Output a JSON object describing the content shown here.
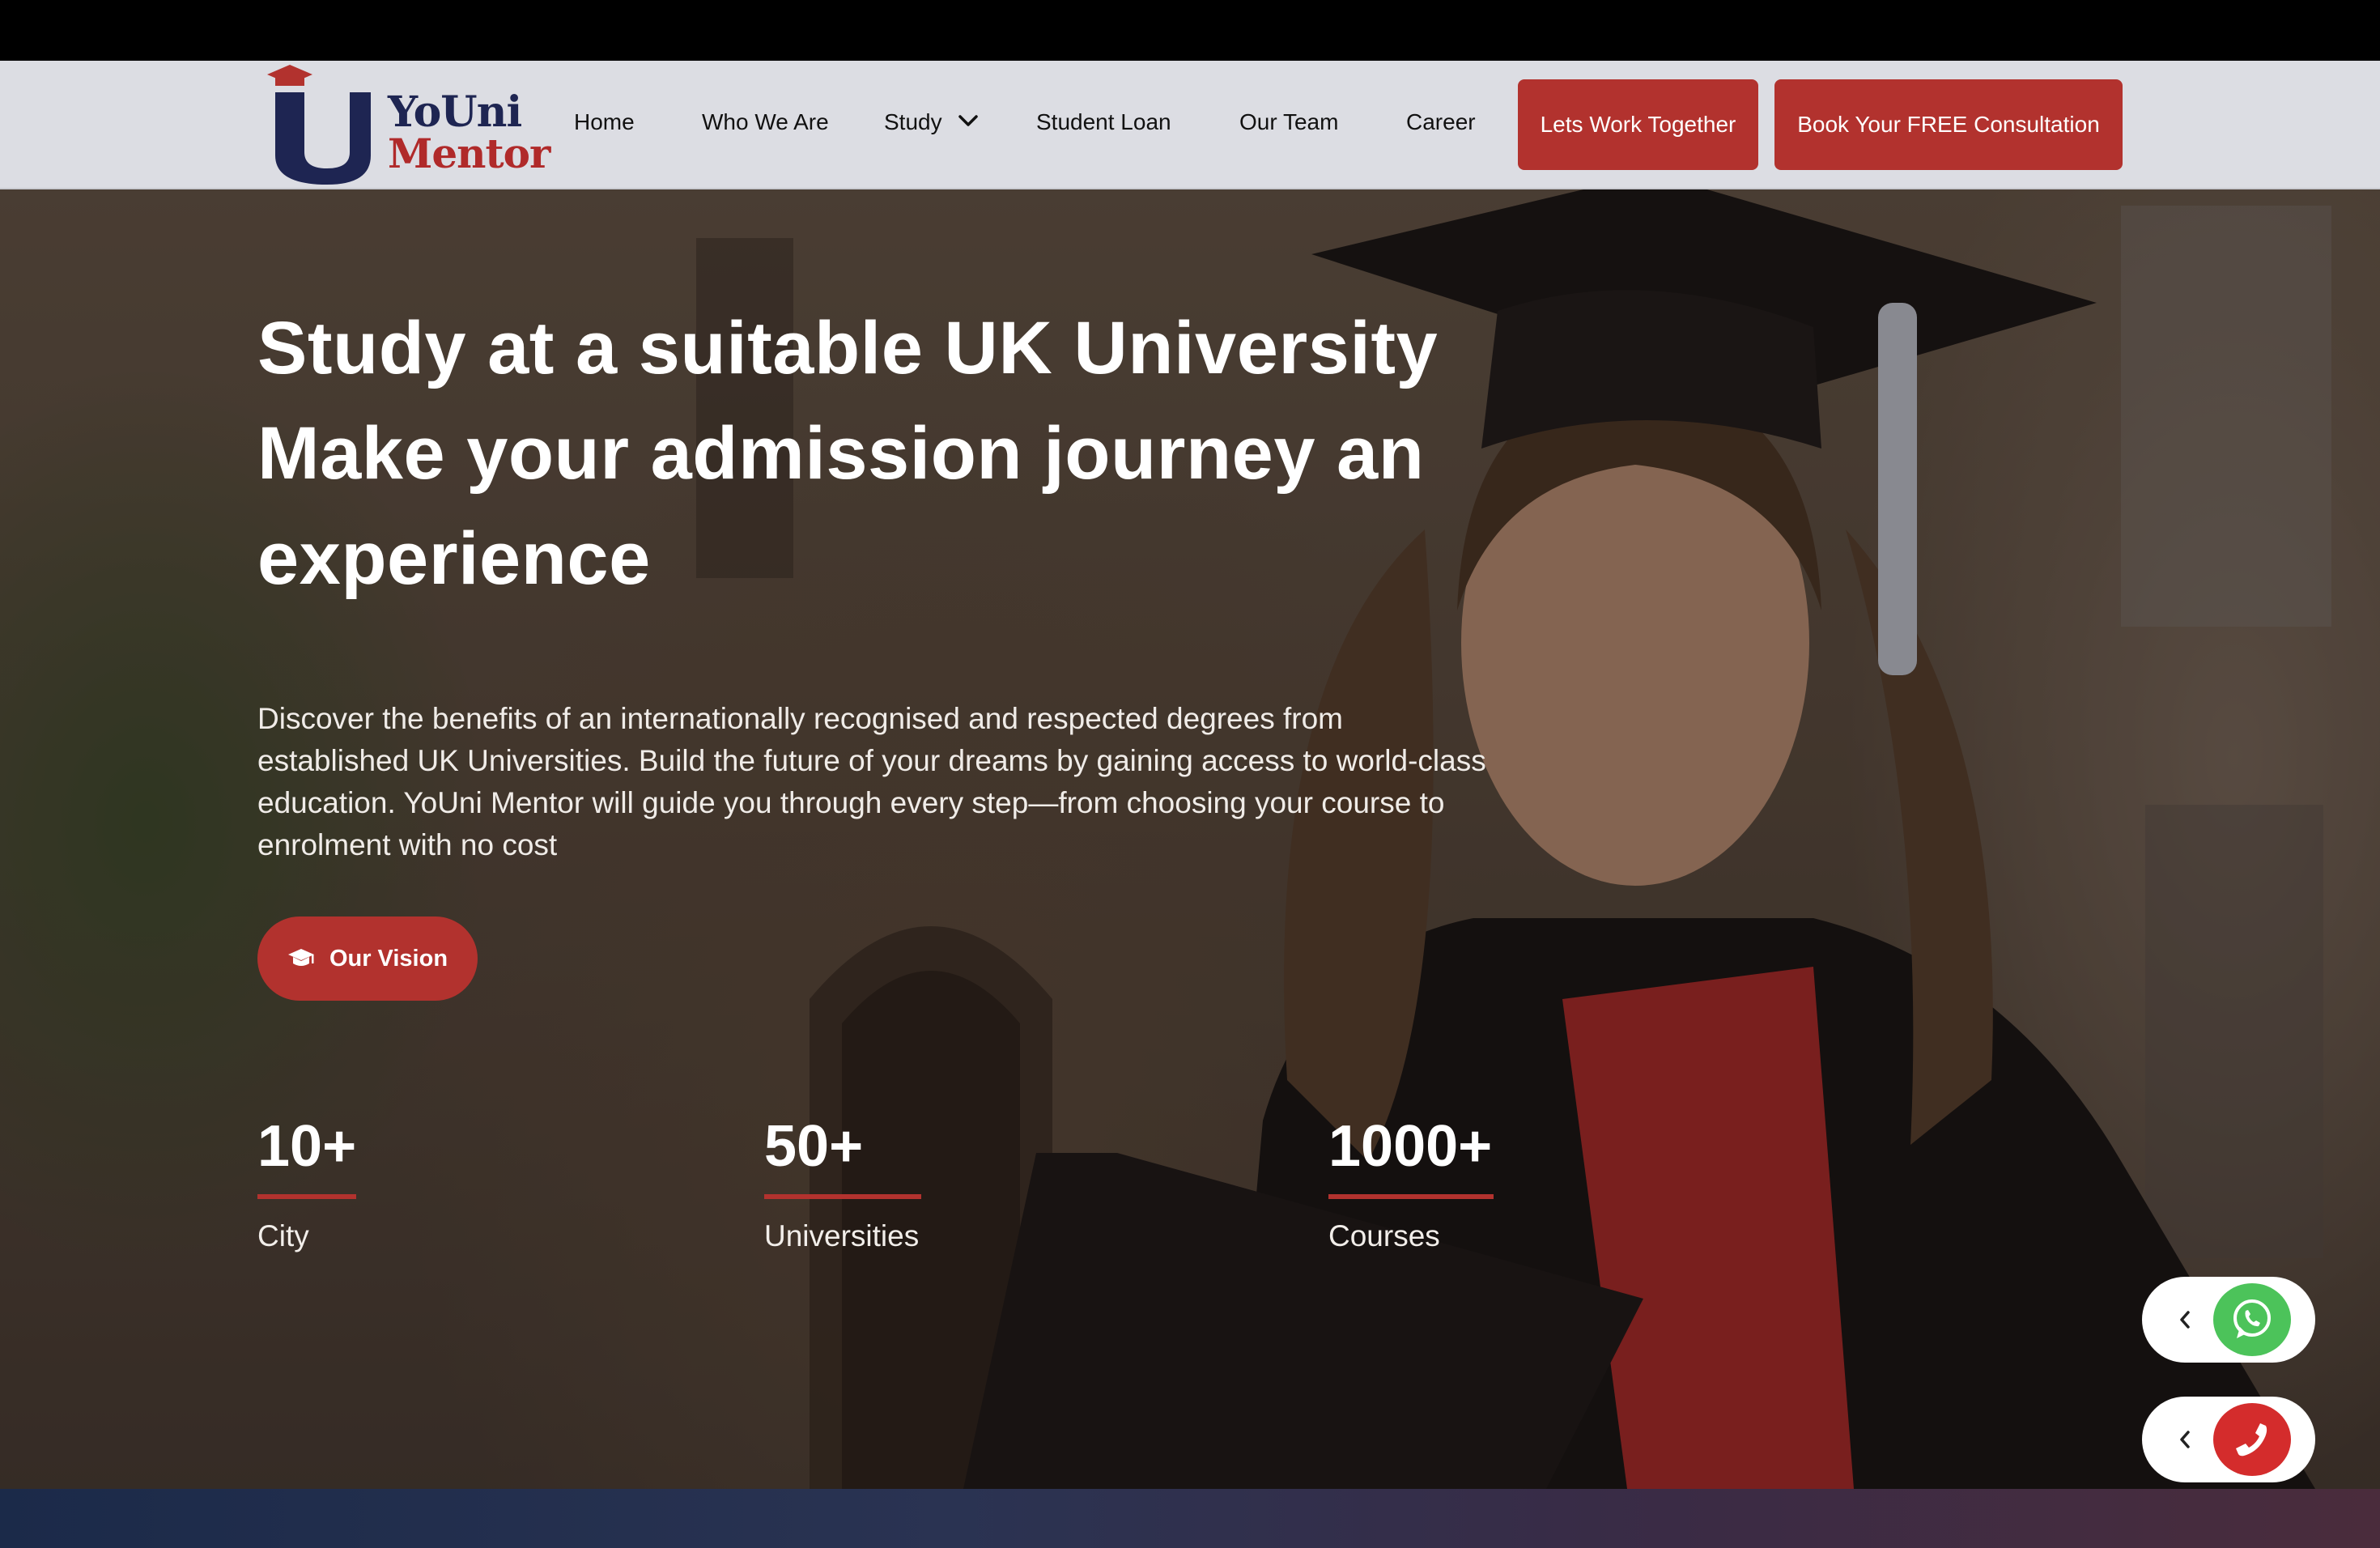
{
  "brand": {
    "line1": "YoUni",
    "line2": "Mentor"
  },
  "nav": {
    "home": "Home",
    "who_we_are": "Who We Are",
    "study": "Study",
    "student_loan": "Student Loan",
    "our_team": "Our Team",
    "career": "Career"
  },
  "cta": {
    "work_together": "Lets Work Together",
    "consultation": "Book Your FREE Consultation"
  },
  "hero": {
    "title_lines": [
      "Study at a suitable UK University",
      "Make your admission journey an",
      "experience"
    ],
    "description": "Discover the benefits of an internationally recognised and respected degrees from established UK Universities. Build the future of your dreams by gaining access to world-class education. YoUni Mentor will guide you through every step—from choosing your course to enrolment with no cost",
    "vision_button": "Our Vision"
  },
  "stats": [
    {
      "value": "10+",
      "label": "City"
    },
    {
      "value": "50+",
      "label": "Universities"
    },
    {
      "value": "1000+",
      "label": "Courses"
    }
  ],
  "icons": {
    "logo": "mortarboard-u-icon",
    "study_dropdown": "chevron-down-icon",
    "vision": "graduation-cap-icon",
    "whatsapp": "whatsapp-icon",
    "phone": "phone-icon",
    "collapse": "chevron-left-icon"
  },
  "colors": {
    "brand_navy": "#1e2552",
    "brand_red": "#b2322e",
    "header_bg": "#dcdde3",
    "whatsapp_green": "#4cc35a",
    "phone_red": "#d42c2c"
  }
}
